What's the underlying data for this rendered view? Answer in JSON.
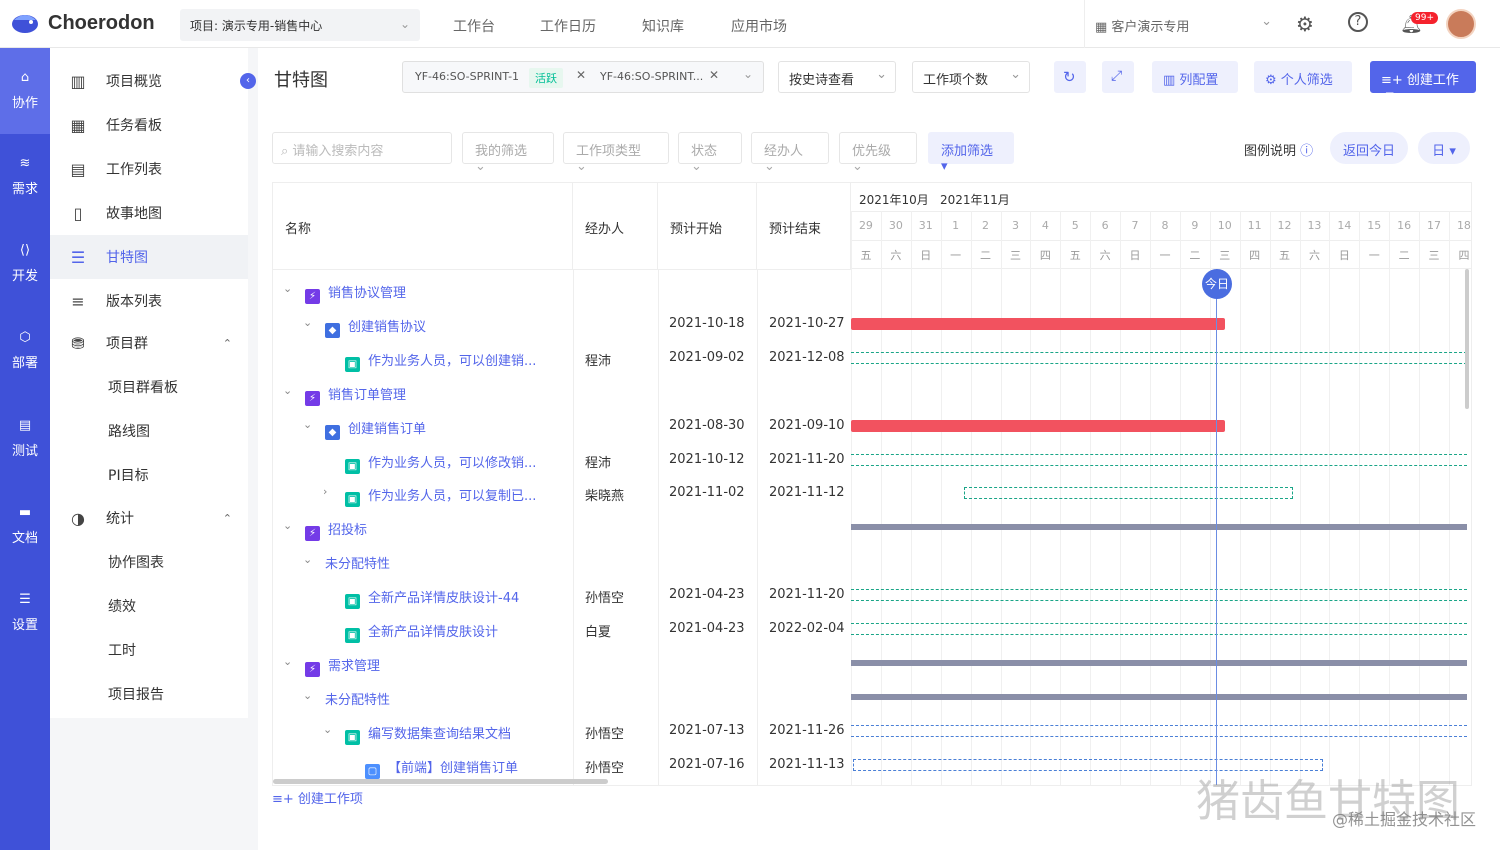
{
  "app": {
    "brand": "Choerodon"
  },
  "topbar": {
    "project": "项目: 演示专用-销售中心",
    "nav": [
      "工作台",
      "工作日历",
      "知识库",
      "应用市场"
    ],
    "client": "客户演示专用",
    "badge": "99+"
  },
  "rail": [
    "协作",
    "需求",
    "开发",
    "部署",
    "测试",
    "文档",
    "设置"
  ],
  "menu": {
    "items": [
      "项目概览",
      "任务看板",
      "工作列表",
      "故事地图",
      "甘特图",
      "版本列表",
      "项目群",
      "项目群看板",
      "路线图",
      "PI目标",
      "统计",
      "协作图表",
      "绩效",
      "工时",
      "项目报告"
    ]
  },
  "toolbar": {
    "title": "甘特图",
    "sprint1": "YF-46:SO-SPRINT-1",
    "sprint1_tag": "活跃",
    "sprint2": "YF-46:SO-SPRINT...",
    "view_by": "按史诗查看",
    "count": "工作项个数",
    "col_config": "列配置",
    "personal_filter": "个人筛选",
    "create": "创建工作项"
  },
  "filters": {
    "search_placeholder": "请输入搜索内容",
    "items": [
      "我的筛选",
      "工作项类型",
      "状态",
      "经办人",
      "优先级"
    ],
    "add": "添加筛选",
    "legend": "图例说明",
    "today": "返回今日",
    "unit": "日"
  },
  "table": {
    "headers": [
      "名称",
      "经办人",
      "预计开始",
      "预计结束"
    ],
    "rows": [
      {
        "name": "销售协议管理",
        "assignee": "",
        "start": "",
        "end": "",
        "type": "epic"
      },
      {
        "name": "创建销售协议",
        "assignee": "",
        "start": "2021-10-18",
        "end": "2021-10-27",
        "type": "feature"
      },
      {
        "name": "作为业务人员，可以创建销...",
        "assignee": "程沛",
        "start": "2021-09-02",
        "end": "2021-12-08",
        "type": "story"
      },
      {
        "name": "销售订单管理",
        "assignee": "",
        "start": "",
        "end": "",
        "type": "epic"
      },
      {
        "name": "创建销售订单",
        "assignee": "",
        "start": "2021-08-30",
        "end": "2021-09-10",
        "type": "feature"
      },
      {
        "name": "作为业务人员，可以修改销...",
        "assignee": "程沛",
        "start": "2021-10-12",
        "end": "2021-11-20",
        "type": "story"
      },
      {
        "name": "作为业务人员，可以复制已...",
        "assignee": "柴晓燕",
        "start": "2021-11-02",
        "end": "2021-11-12",
        "type": "story"
      },
      {
        "name": "招投标",
        "assignee": "",
        "start": "",
        "end": "",
        "type": "epic"
      },
      {
        "name": "未分配特性",
        "assignee": "",
        "start": "",
        "end": "",
        "type": "none"
      },
      {
        "name": "全新产品详情皮肤设计-44",
        "assignee": "孙悟空",
        "start": "2021-04-23",
        "end": "2021-11-20",
        "type": "story"
      },
      {
        "name": "全新产品详情皮肤设计",
        "assignee": "白夏",
        "start": "2021-04-23",
        "end": "2022-02-04",
        "type": "story"
      },
      {
        "name": "需求管理",
        "assignee": "",
        "start": "",
        "end": "",
        "type": "epic"
      },
      {
        "name": "未分配特性",
        "assignee": "",
        "start": "",
        "end": "",
        "type": "none"
      },
      {
        "name": "编写数据集查询结果文档",
        "assignee": "孙悟空",
        "start": "2021-07-13",
        "end": "2021-11-26",
        "type": "story"
      },
      {
        "name": "【前端】创建销售订单",
        "assignee": "孙悟空",
        "start": "2021-07-16",
        "end": "2021-11-13",
        "type": "task"
      }
    ]
  },
  "gantt": {
    "months": [
      "2021年10月",
      "2021年11月"
    ],
    "days": [
      "29",
      "30",
      "31",
      "1",
      "2",
      "3",
      "4",
      "5",
      "6",
      "7",
      "8",
      "9",
      "10",
      "11",
      "12",
      "13",
      "14",
      "15",
      "16",
      "17",
      "18"
    ],
    "weekdays": [
      "五",
      "六",
      "日",
      "一",
      "二",
      "三",
      "四",
      "五",
      "六",
      "日",
      "一",
      "二",
      "三",
      "四",
      "五",
      "六",
      "日",
      "一",
      "二",
      "三",
      "四"
    ],
    "today_label": "今日",
    "colors": {
      "feature_bar": "#f2525f",
      "story_line": "#1aa587",
      "task_line": "#4a7fd6",
      "epic_bar": "#8a8fa8"
    }
  },
  "footer": {
    "create": "创建工作项"
  },
  "watermark": {
    "big": "猪齿鱼甘特图",
    "small": "@稀土掘金技术社区"
  }
}
